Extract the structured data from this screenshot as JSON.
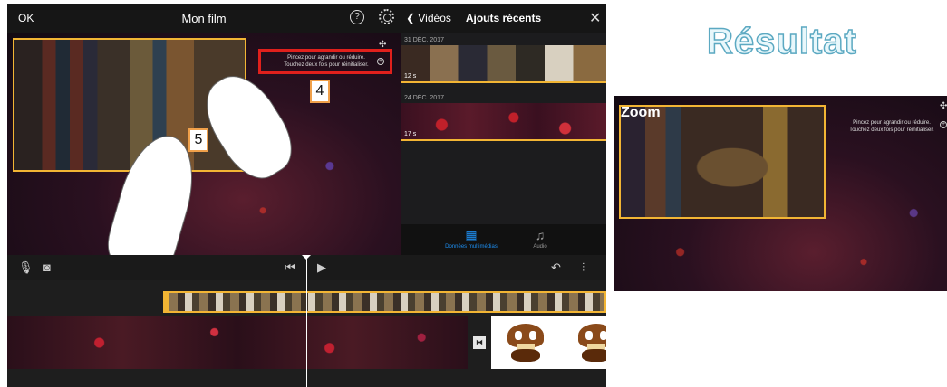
{
  "app": {
    "ok_label": "OK",
    "project_title": "Mon film",
    "help_symbol": "?",
    "viewer": {
      "hint_line1": "Pincez pour agrandir ou réduire.",
      "hint_line2": "Touchez deux fois pour réinitialiser.",
      "callout_4": "4",
      "callout_5": "5"
    },
    "browser": {
      "back_label": "Vidéos",
      "title": "Ajouts récents",
      "sections": [
        {
          "date": "31 DÉC. 2017",
          "duration": "12 s"
        },
        {
          "date": "24 DÉC. 2017",
          "duration": "17 s"
        }
      ],
      "tabs": [
        {
          "label": "Données multimédias",
          "active": true
        },
        {
          "label": "Audio",
          "active": false
        }
      ]
    },
    "controls": {
      "icons": [
        "microphone-icon",
        "camera-icon",
        "skip-back-icon",
        "play-icon",
        "undo-icon",
        "waveform-icon"
      ]
    }
  },
  "result": {
    "heading": "Résultat",
    "zoom_label": "Zoom",
    "hint_line1": "Pincez pour agrandir ou réduire.",
    "hint_line2": "Touchez deux fois pour réinitialiser."
  },
  "colors": {
    "accent_yellow": "#f2b534",
    "highlight_red": "#e0201c",
    "tab_active_blue": "#1e8ef0"
  }
}
